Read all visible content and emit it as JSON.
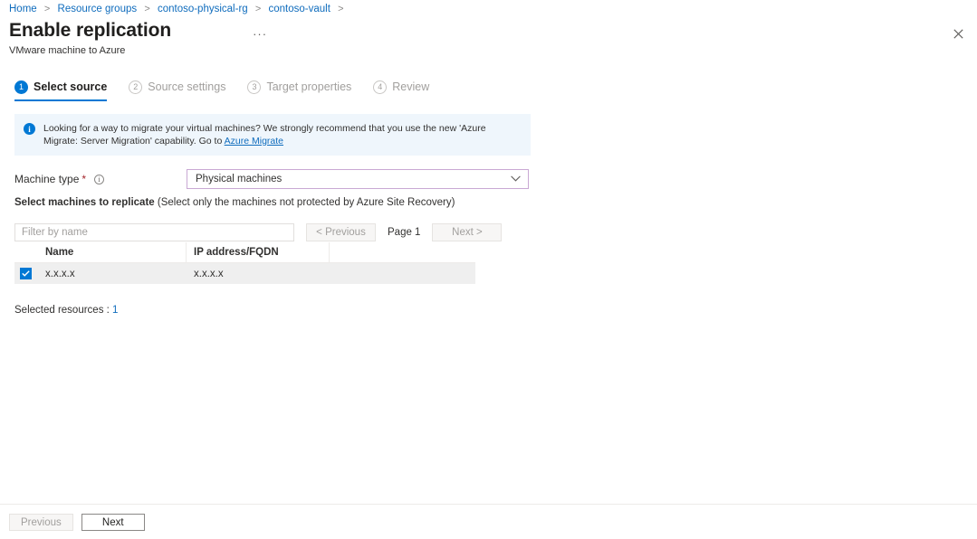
{
  "breadcrumb": {
    "items": [
      {
        "label": "Home"
      },
      {
        "label": "Resource groups"
      },
      {
        "label": "contoso-physical-rg"
      },
      {
        "label": "contoso-vault"
      }
    ],
    "separator": ">"
  },
  "header": {
    "title": "Enable replication",
    "subtitle": "VMware machine to Azure",
    "ellipsis": "···",
    "close_label": "Close"
  },
  "steps": [
    {
      "number": "1",
      "label": "Select source",
      "state": "active"
    },
    {
      "number": "2",
      "label": "Source settings",
      "state": "inactive"
    },
    {
      "number": "3",
      "label": "Target properties",
      "state": "inactive"
    },
    {
      "number": "4",
      "label": "Review",
      "state": "inactive"
    }
  ],
  "info_banner": {
    "icon": "info-icon",
    "text_before": "Looking for a way to migrate your virtual machines? We strongly recommend that you use the new 'Azure Migrate: Server Migration' capability. Go to ",
    "link_label": "Azure Migrate"
  },
  "machine_type": {
    "label": "Machine type",
    "required_marker": "*",
    "tooltip_icon": "info-circle-icon",
    "value": "Physical machines",
    "chevron": "chevron-down-icon"
  },
  "select_machines": {
    "heading_bold": "Select machines to replicate",
    "heading_note": " (Select only the machines not protected by Azure Site Recovery)"
  },
  "toolbar": {
    "filter_placeholder": "Filter by name",
    "filter_value": "",
    "previous_label": "< Previous",
    "page_label": "Page 1",
    "next_label": "Next >"
  },
  "table": {
    "columns": [
      "Name",
      "IP address/FQDN",
      ""
    ],
    "rows": [
      {
        "checked": true,
        "name": "x.x.x.x",
        "ip": "x.x.x.x",
        "extra": ""
      }
    ]
  },
  "selected_resources": {
    "label": "Selected resources : ",
    "count": "1"
  },
  "footer": {
    "previous_label": "Previous",
    "next_label": "Next"
  },
  "colors": {
    "accent": "#0078d4",
    "link": "#0f6cbd",
    "banner_bg": "#eff6fc",
    "required": "#a4262c",
    "dropdown_border": "#c9a8d4",
    "row_bg": "#efefef"
  }
}
